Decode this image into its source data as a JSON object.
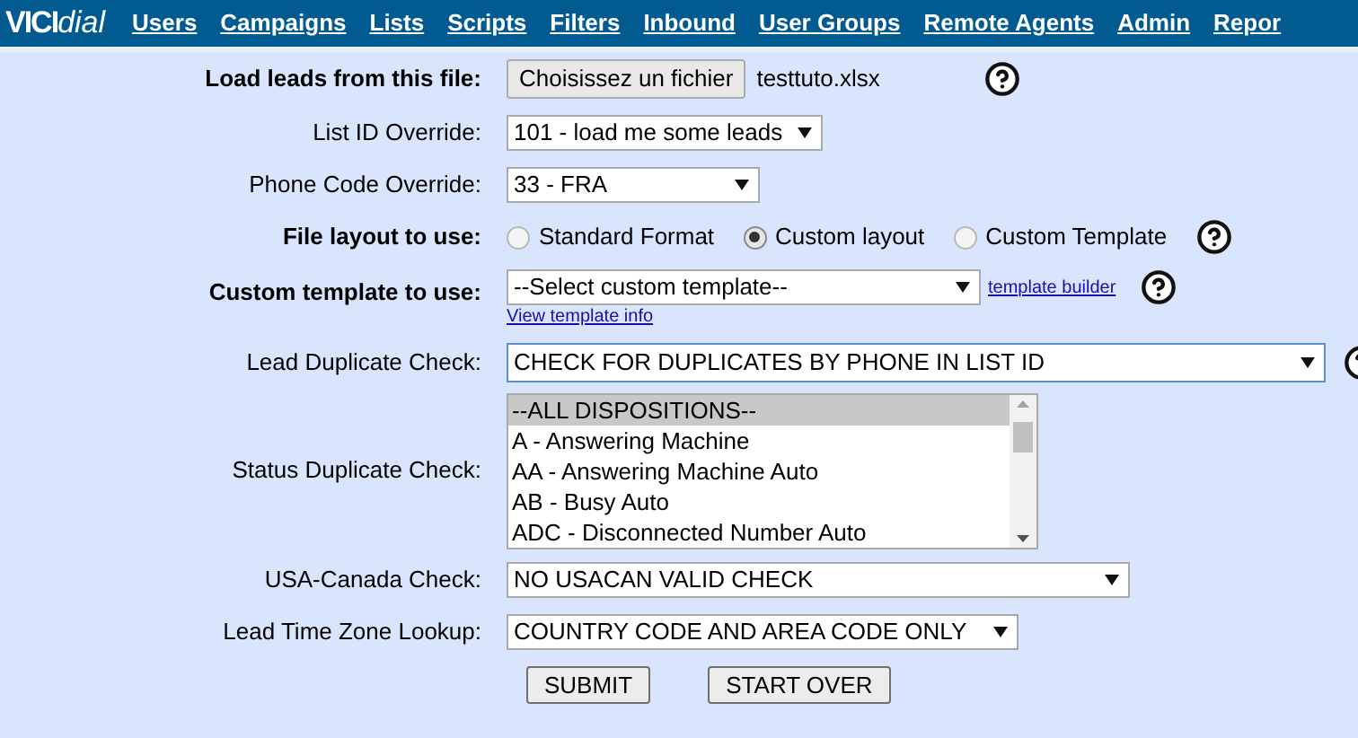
{
  "logo": {
    "strong": "VICI",
    "light": "dial"
  },
  "nav": [
    "Users",
    "Campaigns",
    "Lists",
    "Scripts",
    "Filters",
    "Inbound",
    "User Groups",
    "Remote Agents",
    "Admin",
    "Repor"
  ],
  "form": [
    {
      "kind": "file",
      "label": "Load leads from this file:",
      "emphasis": true,
      "button": "Choisissez un fichier",
      "filename": "testtuto.xlsx",
      "help": true
    },
    {
      "kind": "select",
      "label": "List ID Override:",
      "emphasis": false,
      "value": "101 - load me some leads",
      "help": false
    },
    {
      "kind": "select",
      "label": "Phone Code Override:",
      "emphasis": false,
      "value": "33 - FRA",
      "help": false
    },
    {
      "kind": "radio",
      "label": "File layout to use:",
      "emphasis": true,
      "options": [
        {
          "label": "Standard Format",
          "selected": false
        },
        {
          "label": "Custom layout",
          "selected": true
        },
        {
          "label": "Custom Template",
          "selected": false
        }
      ],
      "help": true
    },
    {
      "kind": "template",
      "label": "Custom template to use:",
      "emphasis": true,
      "value": "--Select custom template--",
      "link": "template builder",
      "sublink": "View template info",
      "help": true
    },
    {
      "kind": "select",
      "label": "Lead Duplicate Check:",
      "emphasis": false,
      "value": "CHECK FOR DUPLICATES BY PHONE IN LIST ID",
      "focused": true,
      "help": true
    },
    {
      "kind": "listbox",
      "label": "Status Duplicate Check:",
      "emphasis": false,
      "items": [
        {
          "label": "--ALL DISPOSITIONS--",
          "selected": true
        },
        {
          "label": "A - Answering Machine",
          "selected": false
        },
        {
          "label": "AA - Answering Machine Auto",
          "selected": false
        },
        {
          "label": "AB - Busy Auto",
          "selected": false
        },
        {
          "label": "ADC - Disconnected Number Auto",
          "selected": false
        }
      ],
      "help": false
    },
    {
      "kind": "select",
      "label": "USA-Canada Check:",
      "emphasis": false,
      "value": "NO USACAN VALID CHECK",
      "help": false
    },
    {
      "kind": "select",
      "label": "Lead Time Zone Lookup:",
      "emphasis": false,
      "value": "COUNTRY CODE AND AREA CODE ONLY",
      "help": false
    }
  ],
  "buttons": [
    "SUBMIT",
    "START OVER"
  ]
}
